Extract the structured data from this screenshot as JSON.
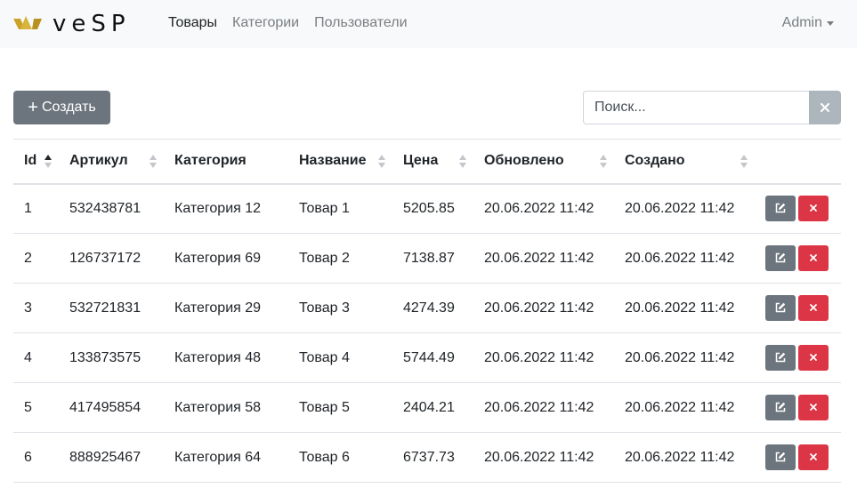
{
  "app": {
    "logo_text": "veSP",
    "brand_color": "#c9a227"
  },
  "nav": {
    "items": [
      {
        "label": "Товары",
        "active": true
      },
      {
        "label": "Категории",
        "active": false
      },
      {
        "label": "Пользователи",
        "active": false
      }
    ],
    "user": "Admin"
  },
  "toolbar": {
    "create_label": "Создать",
    "search_placeholder": "Поиск...",
    "clear_icon": "close-icon"
  },
  "table": {
    "columns": [
      {
        "label": "Id",
        "sortable": true,
        "sort": "asc"
      },
      {
        "label": "Артикул",
        "sortable": true
      },
      {
        "label": "Категория",
        "sortable": false
      },
      {
        "label": "Название",
        "sortable": true
      },
      {
        "label": "Цена",
        "sortable": true
      },
      {
        "label": "Обновлено",
        "sortable": true
      },
      {
        "label": "Создано",
        "sortable": true
      }
    ],
    "rows": [
      {
        "id": "1",
        "sku": "532438781",
        "category": "Категория 12",
        "name": "Товар 1",
        "price": "5205.85",
        "updated": "20.06.2022 11:42",
        "created": "20.06.2022 11:42"
      },
      {
        "id": "2",
        "sku": "126737172",
        "category": "Категория 69",
        "name": "Товар 2",
        "price": "7138.87",
        "updated": "20.06.2022 11:42",
        "created": "20.06.2022 11:42"
      },
      {
        "id": "3",
        "sku": "532721831",
        "category": "Категория 29",
        "name": "Товар 3",
        "price": "4274.39",
        "updated": "20.06.2022 11:42",
        "created": "20.06.2022 11:42"
      },
      {
        "id": "4",
        "sku": "133873575",
        "category": "Категория 48",
        "name": "Товар 4",
        "price": "5744.49",
        "updated": "20.06.2022 11:42",
        "created": "20.06.2022 11:42"
      },
      {
        "id": "5",
        "sku": "417495854",
        "category": "Категория 58",
        "name": "Товар 5",
        "price": "2404.21",
        "updated": "20.06.2022 11:42",
        "created": "20.06.2022 11:42"
      },
      {
        "id": "6",
        "sku": "888925467",
        "category": "Категория 64",
        "name": "Товар 6",
        "price": "6737.73",
        "updated": "20.06.2022 11:42",
        "created": "20.06.2022 11:42"
      }
    ],
    "row_actions": {
      "edit_icon": "edit-icon",
      "delete_icon": "close-icon"
    }
  }
}
